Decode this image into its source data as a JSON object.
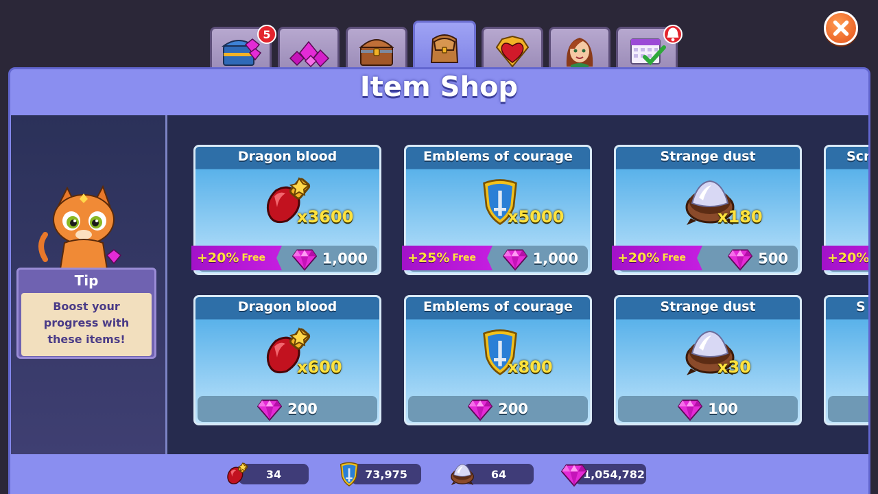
{
  "tabs": [
    {
      "name": "treasure-chest-gems",
      "badge": "5"
    },
    {
      "name": "gem-pile",
      "badge": ""
    },
    {
      "name": "wooden-chest",
      "badge": ""
    },
    {
      "name": "backpack",
      "badge": "",
      "active": true
    },
    {
      "name": "heart-emblem",
      "badge": ""
    },
    {
      "name": "heroine-portrait",
      "badge": ""
    },
    {
      "name": "calendar-check",
      "badge": "alert"
    }
  ],
  "title": "Item Shop",
  "tip": {
    "title": "Tip",
    "text_line1": "Boost your",
    "text_line2": "progress with",
    "text_line3": "these items!"
  },
  "cards": [
    {
      "title": "Dragon blood",
      "qty": "x3600",
      "bonus_pct": "+20%",
      "bonus_label": "Free",
      "price": "1,000",
      "icon": "dragon-blood-icon"
    },
    {
      "title": "Emblems of courage",
      "qty": "x5000",
      "bonus_pct": "+25%",
      "bonus_label": "Free",
      "price": "1,000",
      "icon": "emblem-of-courage-icon"
    },
    {
      "title": "Strange dust",
      "qty": "x180",
      "bonus_pct": "+20%",
      "bonus_label": "Free",
      "price": "500",
      "icon": "strange-dust-icon"
    },
    {
      "title": "Scr",
      "bonus_pct": "+20%"
    },
    {
      "title": "Dragon blood",
      "qty": "x600",
      "price": "200",
      "icon": "dragon-blood-icon"
    },
    {
      "title": "Emblems of courage",
      "qty": "x800",
      "price": "200",
      "icon": "emblem-of-courage-icon"
    },
    {
      "title": "Strange dust",
      "qty": "x30",
      "price": "100",
      "icon": "strange-dust-icon"
    },
    {
      "title": "S"
    }
  ],
  "resources": {
    "dragon_blood": "34",
    "emblems": "73,975",
    "strange_dust": "64",
    "gems": "1,054,782"
  },
  "colors": {
    "panel": "#8a8ef0",
    "content_bg": "#262b4e",
    "card_header": "#2e6fa8",
    "qty_yellow": "#ffe23d",
    "bonus_purple": "#b518d6",
    "gem_pink": "#e42bd6"
  }
}
